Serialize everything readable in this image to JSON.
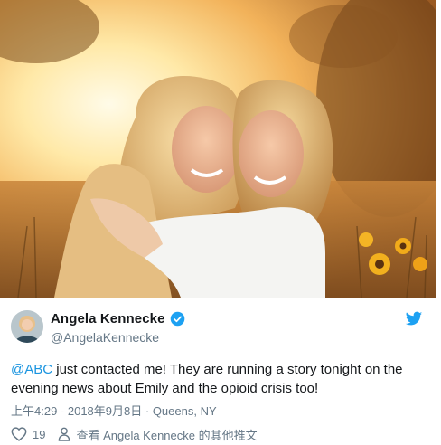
{
  "tweet": {
    "author": {
      "display_name": "Angela Kennecke",
      "handle": "@AngelaKennecke",
      "verified_icon": "verified-badge-icon",
      "avatar_icon": "user-avatar"
    },
    "brand_icon": "twitter-bird-icon",
    "text_mention": "@ABC",
    "text_body": " just contacted me! They are running a story tonight on the evening news about Emily and the opioid crisis too!",
    "timestamp": "上午4:29 - 2018年9月8日",
    "location_sep": " · ",
    "location": "Queens, NY",
    "like_count": "19",
    "profile_link_label": "查看 Angela Kennecke 的其他推文"
  },
  "colors": {
    "accent": "#1b95e0",
    "text": "#14171a",
    "muted": "#657786"
  }
}
